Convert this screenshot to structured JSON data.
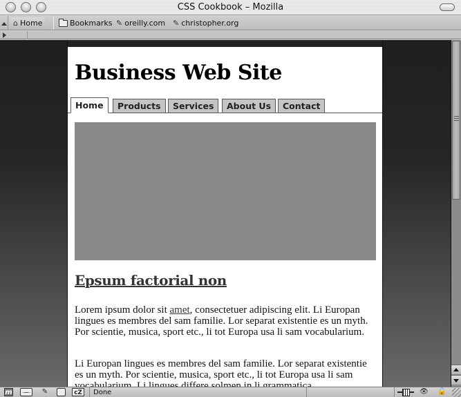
{
  "window": {
    "title": "CSS Cookbook – Mozilla"
  },
  "bookmarks_toolbar": {
    "items": [
      {
        "label": "Home",
        "icon": "home-icon"
      },
      {
        "label": "Bookmarks",
        "icon": "folder-icon"
      },
      {
        "label": "oreilly.com",
        "icon": "bookmark-icon"
      },
      {
        "label": "christopher.org",
        "icon": "bookmark-icon"
      }
    ]
  },
  "page": {
    "site_title": "Business Web Site",
    "tabs": [
      {
        "label": "Home",
        "active": true
      },
      {
        "label": "Products",
        "active": false
      },
      {
        "label": "Services",
        "active": false
      },
      {
        "label": "About Us",
        "active": false
      },
      {
        "label": "Contact",
        "active": false
      }
    ],
    "heading": "Epsum factorial non",
    "paragraph1": {
      "before_link": "Lorem ipsum dolor sit ",
      "link": "amet",
      "after_link": ", consectetuer adipiscing elit. Li Europan lingues es membres del sam familie. Lor separat existentie es un myth. Por scientie, musica, sport etc., li tot Europa usa li sam vocabularium."
    },
    "paragraph2": "Li Europan lingues es membres del sam familie. Lor separat existentie es un myth. Por scientie, musica, sport etc., li tot Europa usa li sam vocabularium. Li lingues differe solmen in li grammatica"
  },
  "statusbar": {
    "status_text": "Done",
    "left_icons": [
      "mozilla-icon",
      "mail-icon",
      "composer-icon",
      "address-book-icon",
      "chatzilla-icon"
    ],
    "right_icons": [
      "online-icon",
      "privacy-icon",
      "security-lock-icon"
    ],
    "chatzilla_label": "cZ",
    "mozilla_label": "m"
  },
  "colors": {
    "tab_bg": "#c4c4c4",
    "hero_bg": "#8a8a8a",
    "heading_color": "#333333"
  }
}
